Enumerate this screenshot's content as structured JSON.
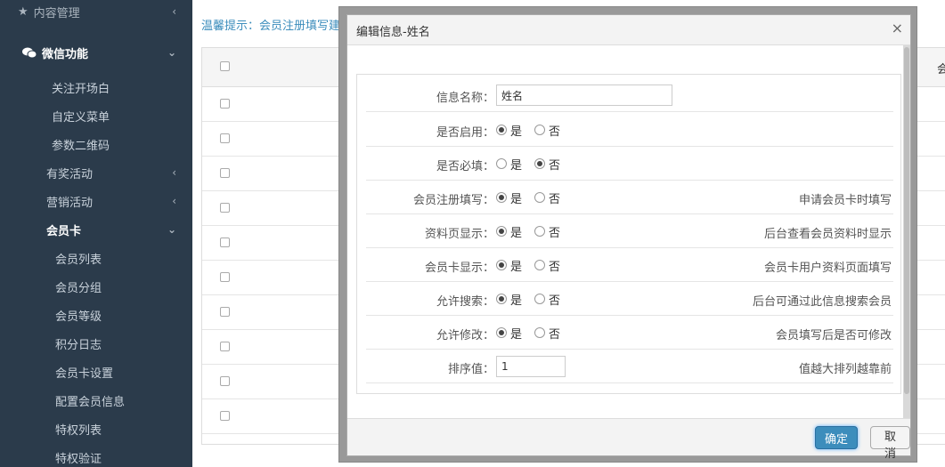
{
  "sidebar": {
    "top_item": {
      "label": "内容管理",
      "icon": "star-icon"
    },
    "wechat": {
      "label": "微信功能",
      "icon": "wechat-icon"
    },
    "wechat_items": [
      "关注开场白",
      "自定义菜单",
      "参数二维码"
    ],
    "groups": [
      {
        "label": "有奖活动",
        "expanded": false
      },
      {
        "label": "营销活动",
        "expanded": false
      },
      {
        "label": "会员卡",
        "expanded": true
      }
    ],
    "card_items": [
      "会员列表",
      "会员分组",
      "会员等级",
      "积分日志",
      "会员卡设置",
      "配置会员信息",
      "特权列表",
      "特权验证"
    ]
  },
  "main": {
    "tip": "温馨提示：会员注册填写建议",
    "header_right": "会"
  },
  "modal": {
    "title": "编辑信息-姓名",
    "close": "×",
    "fields": {
      "name": {
        "label": "信息名称：",
        "value": "姓名"
      },
      "enabled": {
        "label": "是否启用：",
        "selected": "是",
        "hint": ""
      },
      "required": {
        "label": "是否必填：",
        "selected": "否",
        "hint": ""
      },
      "register": {
        "label": "会员注册填写：",
        "selected": "是",
        "hint": "申请会员卡时填写"
      },
      "profile": {
        "label": "资料页显示：",
        "selected": "是",
        "hint": "后台查看会员资料时显示"
      },
      "card": {
        "label": "会员卡显示：",
        "selected": "是",
        "hint": "会员卡用户资料页面填写"
      },
      "search": {
        "label": "允许搜索：",
        "selected": "是",
        "hint": "后台可通过此信息搜索会员"
      },
      "edit": {
        "label": "允许修改：",
        "selected": "是",
        "hint": "会员填写后是否可修改"
      },
      "sort": {
        "label": "排序值：",
        "value": "1",
        "hint": "值越大排列越靠前"
      }
    },
    "yes": "是",
    "no": "否",
    "ok": "确定",
    "cancel": "取消"
  }
}
